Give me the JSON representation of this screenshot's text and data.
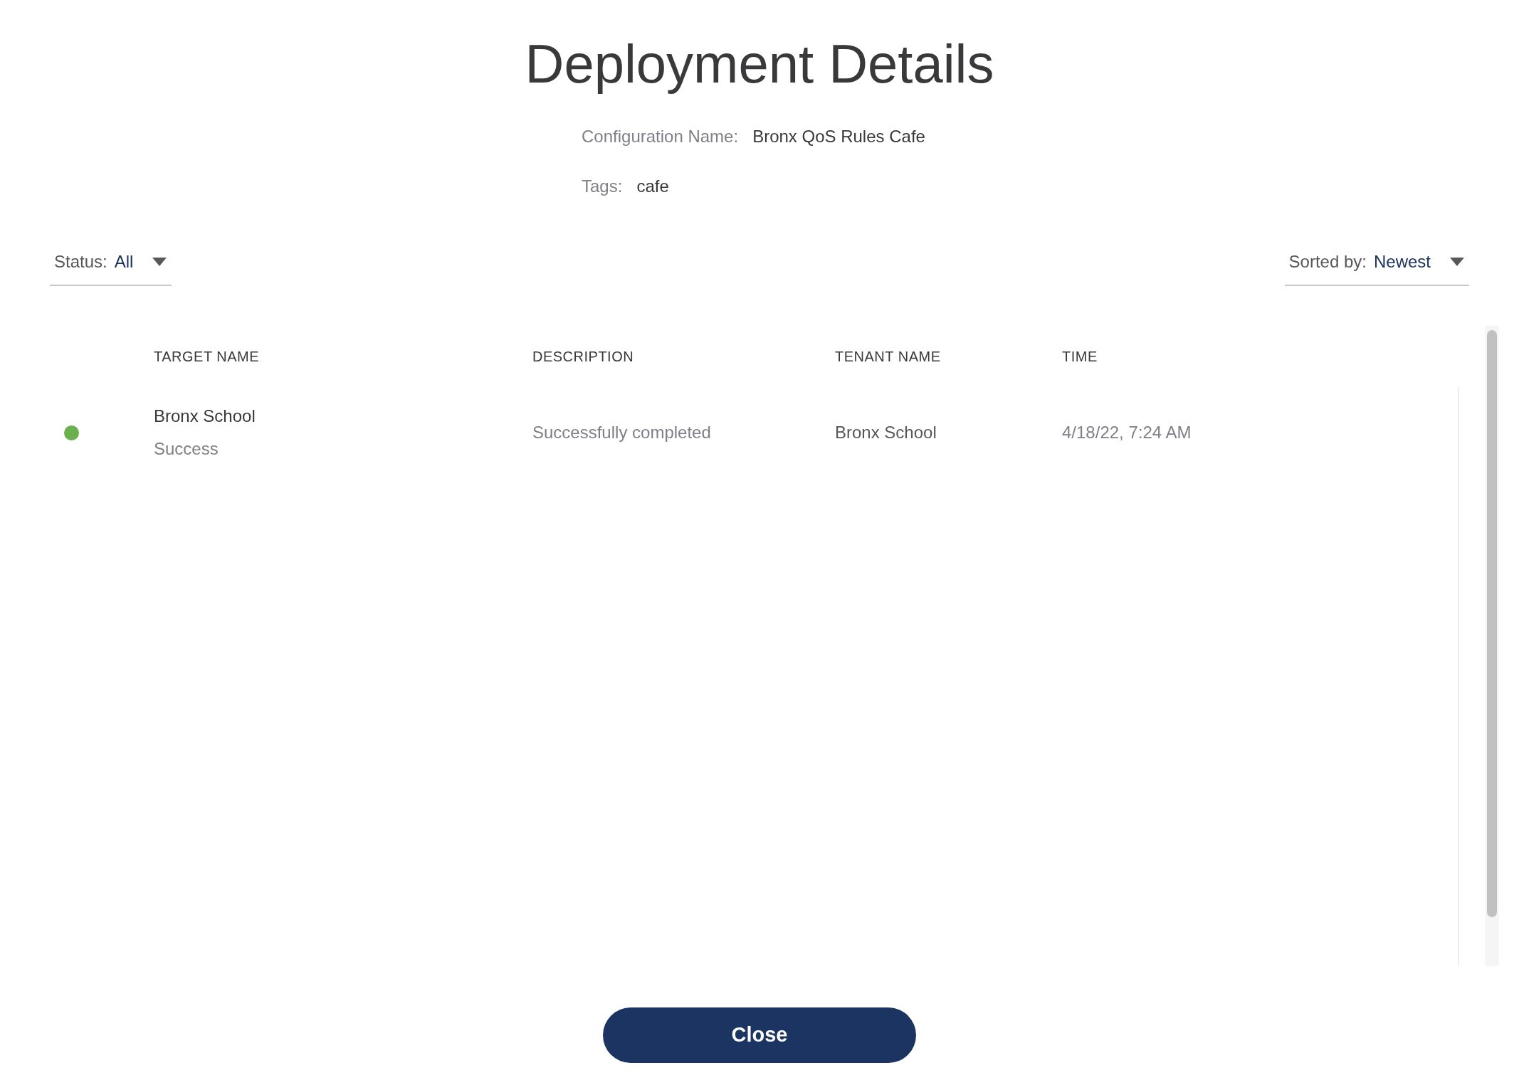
{
  "title": "Deployment Details",
  "configuration": {
    "label": "Configuration Name:",
    "value": "Bronx QoS Rules Cafe"
  },
  "tags": {
    "label": "Tags:",
    "value": "cafe"
  },
  "status_filter": {
    "label": "Status:",
    "value": "All"
  },
  "sort": {
    "label": "Sorted by:",
    "value": "Newest"
  },
  "table": {
    "columns": [
      "TARGET NAME",
      "DESCRIPTION",
      "TENANT NAME",
      "TIME"
    ],
    "rows": [
      {
        "color": "#6ab04c",
        "target_name": "Bronx School",
        "status": "Success",
        "description": "Successfully completed",
        "tenant_name": "Bronx School",
        "time": "4/18/22, 7:24 AM"
      }
    ]
  },
  "close_button": "Close"
}
